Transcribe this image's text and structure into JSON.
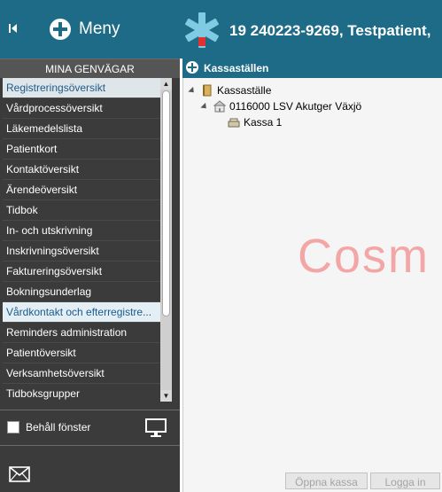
{
  "header": {
    "menu_label": "Meny",
    "patient_id": "19 240223-9269,  Testpatient,"
  },
  "sidebar": {
    "title": "MINA GENVÄGAR",
    "items": [
      {
        "label": "Registreringsöversikt"
      },
      {
        "label": "Vårdprocessöversikt"
      },
      {
        "label": "Läkemedelslista"
      },
      {
        "label": "Patientkort"
      },
      {
        "label": "Kontaktöversikt"
      },
      {
        "label": "Ärendeöversikt"
      },
      {
        "label": "Tidbok"
      },
      {
        "label": "In- och utskrivning"
      },
      {
        "label": "Inskrivningsöversikt"
      },
      {
        "label": "Faktureringsöversikt"
      },
      {
        "label": "Bokningsunderlag"
      },
      {
        "label": "Vårdkontakt och efterregistre..."
      },
      {
        "label": "Reminders administration"
      },
      {
        "label": "Patientöversikt"
      },
      {
        "label": "Verksamhetsöversikt"
      },
      {
        "label": "Tidboksgrupper"
      }
    ],
    "keep_window_label": "Behåll fönster",
    "keep_window_checked": false
  },
  "panel": {
    "title": "Kassaställen",
    "tree": {
      "root": "Kassaställe",
      "unit": "0116000 LSV Akutger Växjö",
      "register": "Kassa 1"
    },
    "watermark": "Cosm",
    "buttons": {
      "open": "Öppna kassa",
      "login": "Logga in"
    }
  },
  "colors": {
    "header_bg": "#1e6b87",
    "sidebar_bg": "#3b3b3b",
    "watermark": "#f2a6a6",
    "logo_blue": "#7fcbe3",
    "logo_red": "#e03030"
  },
  "icons": {
    "collapse": "collapse-left-icon",
    "menu": "plus-circle-icon",
    "logo": "medical-star-icon",
    "monitor": "monitor-icon",
    "mail": "mail-icon",
    "tree_root": "door-icon",
    "tree_unit": "building-icon",
    "tree_register": "cash-register-icon"
  }
}
